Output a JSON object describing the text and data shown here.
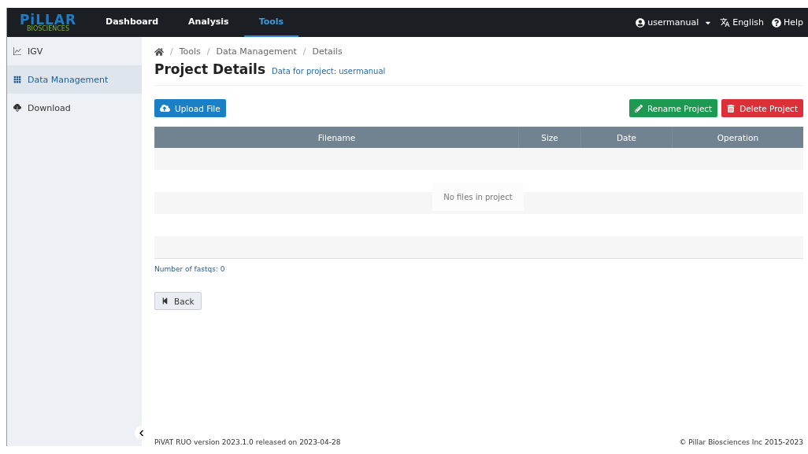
{
  "navbar": {
    "logo": {
      "name": "PiLLAR",
      "tagline": "BIOSCIENCES"
    },
    "tabs": [
      {
        "label": "Dashboard",
        "selected": false
      },
      {
        "label": "Analysis",
        "selected": false
      },
      {
        "label": "Tools",
        "selected": true
      }
    ],
    "user": "usermanual",
    "language": "English",
    "help": "Help"
  },
  "sidebar": {
    "items": [
      {
        "label": "IGV",
        "kind": "chart",
        "selected": false
      },
      {
        "label": "Data Management",
        "kind": "grid",
        "selected": true
      },
      {
        "label": "Download",
        "kind": "cloud",
        "selected": false
      }
    ]
  },
  "breadcrumb": {
    "separator": "/",
    "items": [
      "Tools",
      "Data Management",
      "Details"
    ]
  },
  "page": {
    "title": "Project Details",
    "subtitle": "Data for project: usermanual"
  },
  "buttons": {
    "upload": "Upload File",
    "rename": "Rename Project",
    "delete": "Delete Project",
    "back": "Back"
  },
  "table": {
    "columns": [
      "Filename",
      "Size",
      "Date",
      "Operation"
    ],
    "empty_message": "No files in project"
  },
  "summary": "Number of fastqs: 0",
  "footer": {
    "version": "PiVAT RUO version 2023.1.0 released on 2023-04-28",
    "copyright": "© Pillar Biosciences Inc 2015-2023"
  }
}
